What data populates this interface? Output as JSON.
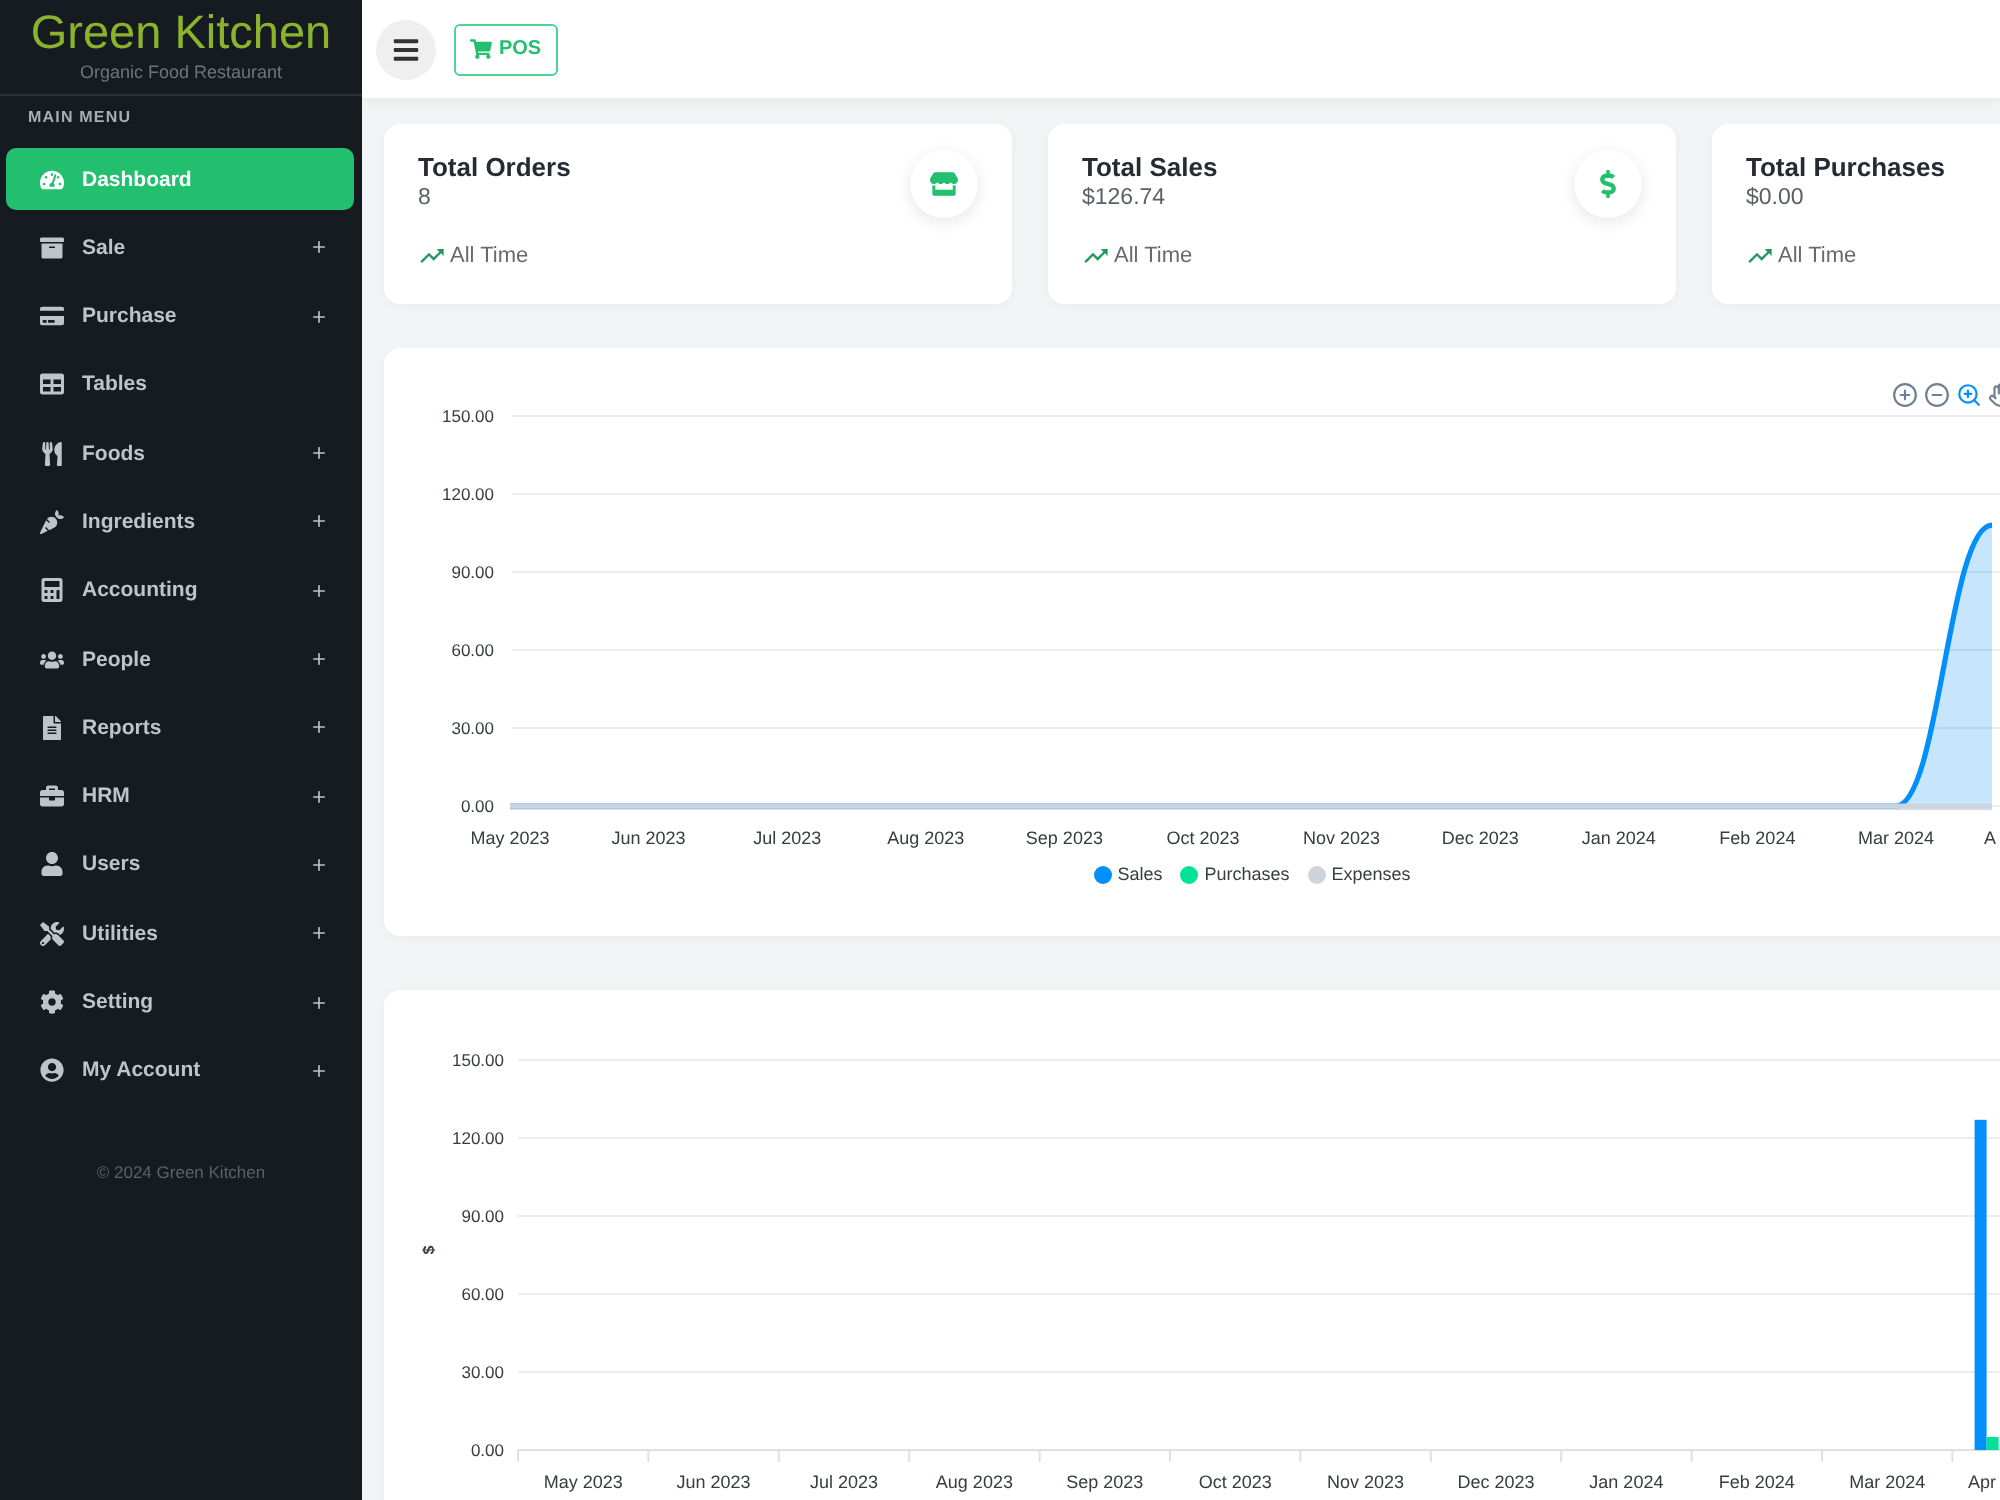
{
  "sidebar": {
    "logo_title": "Green Kitchen",
    "logo_subtitle": "Organic Food Restaurant",
    "section_label": "MAIN MENU",
    "items": [
      {
        "label": "Dashboard",
        "selected": true,
        "expandable": false
      },
      {
        "label": "Sale",
        "selected": false,
        "expandable": true
      },
      {
        "label": "Purchase",
        "selected": false,
        "expandable": true
      },
      {
        "label": "Tables",
        "selected": false,
        "expandable": false
      },
      {
        "label": "Foods",
        "selected": false,
        "expandable": true
      },
      {
        "label": "Ingredients",
        "selected": false,
        "expandable": true
      },
      {
        "label": "Accounting",
        "selected": false,
        "expandable": true
      },
      {
        "label": "People",
        "selected": false,
        "expandable": true
      },
      {
        "label": "Reports",
        "selected": false,
        "expandable": true
      },
      {
        "label": "HRM",
        "selected": false,
        "expandable": true
      },
      {
        "label": "Users",
        "selected": false,
        "expandable": true
      },
      {
        "label": "Utilities",
        "selected": false,
        "expandable": true
      },
      {
        "label": "Setting",
        "selected": false,
        "expandable": true
      },
      {
        "label": "My Account",
        "selected": false,
        "expandable": true
      }
    ],
    "footer": "© 2024 Green Kitchen"
  },
  "topbar": {
    "pos_button": "POS"
  },
  "stat_cards": [
    {
      "title": "Total Orders",
      "value": "8",
      "period": "All Time"
    },
    {
      "title": "Total Sales",
      "value": "$126.74",
      "period": "All Time"
    },
    {
      "title": "Total Purchases",
      "value": "$0.00",
      "period": "All Time"
    }
  ],
  "line_chart_card": {
    "toolbar": [
      {
        "kind": "zoom-in",
        "selected": false
      },
      {
        "kind": "zoom-out",
        "selected": false
      },
      {
        "kind": "zoom",
        "selected": true
      },
      {
        "kind": "pan",
        "selected": false
      }
    ],
    "chart_data": {
      "type": "area",
      "grid": true,
      "legend": "bottom",
      "categories": [
        "May 2023",
        "Jun 2023",
        "Jul 2023",
        "Aug 2023",
        "Sep 2023",
        "Oct 2023",
        "Nov 2023",
        "Dec 2023",
        "Jan 2024",
        "Feb 2024",
        "Mar 2024",
        "A"
      ],
      "ylim": [
        0,
        150
      ],
      "yticks": [
        {
          "value": 0,
          "label": "0.00"
        },
        {
          "value": 30,
          "label": "30.00"
        },
        {
          "value": 60,
          "label": "60.00"
        },
        {
          "value": 90,
          "label": "90.00"
        },
        {
          "value": 120,
          "label": "120.00"
        },
        {
          "value": 150,
          "label": "150.00"
        }
      ],
      "series": [
        {
          "name": "Sales",
          "color": "#008ffb",
          "values": [
            0,
            0,
            0,
            0,
            0,
            0,
            0,
            0,
            0,
            0,
            0,
            108
          ]
        },
        {
          "name": "Purchases",
          "color": "#00e396",
          "values": [
            null,
            null,
            null,
            null,
            null,
            null,
            null,
            null,
            null,
            null,
            null,
            null
          ]
        },
        {
          "name": "Expenses",
          "color": "#ced4dc",
          "values": [
            0,
            0,
            0,
            0,
            0,
            0,
            0,
            0,
            0,
            0,
            0,
            0
          ]
        }
      ]
    }
  },
  "bar_chart_card": {
    "chart_data": {
      "type": "bar",
      "grid": true,
      "ylabel": "$",
      "categories": [
        "May 2023",
        "Jun 2023",
        "Jul 2023",
        "Aug 2023",
        "Sep 2023",
        "Oct 2023",
        "Nov 2023",
        "Dec 2023",
        "Jan 2024",
        "Feb 2024",
        "Mar 2024",
        "Apr"
      ],
      "ylim": [
        0,
        150
      ],
      "yticks": [
        {
          "value": 0,
          "label": "0.00"
        },
        {
          "value": 30,
          "label": "30.00"
        },
        {
          "value": 60,
          "label": "60.00"
        },
        {
          "value": 90,
          "label": "90.00"
        },
        {
          "value": 120,
          "label": "120.00"
        },
        {
          "value": 150,
          "label": "150.00"
        }
      ],
      "series": [
        {
          "color": "#008ffb",
          "values": [
            0,
            0,
            0,
            0,
            0,
            0,
            0,
            0,
            0,
            0,
            0,
            127
          ]
        },
        {
          "color": "#00e396",
          "values": [
            0,
            0,
            0,
            0,
            0,
            0,
            0,
            0,
            0,
            0,
            0,
            5
          ]
        }
      ]
    }
  }
}
